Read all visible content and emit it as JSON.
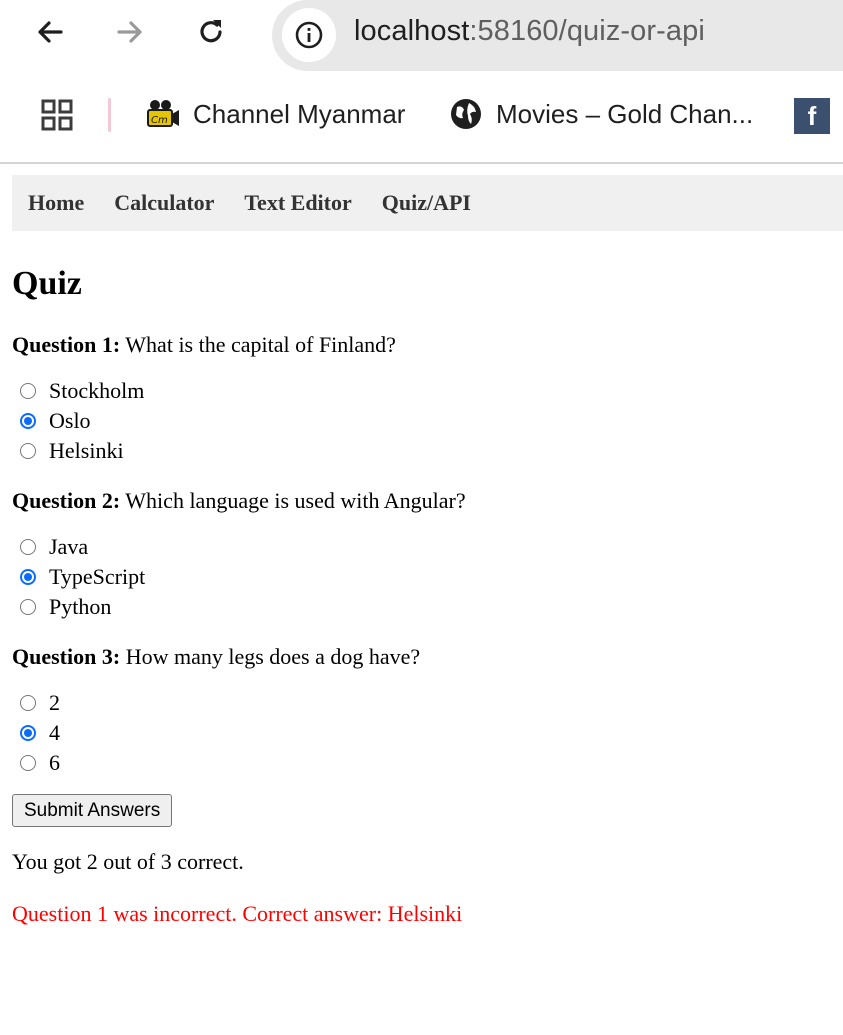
{
  "browser": {
    "url_host": "localhost",
    "url_rest": ":58160/quiz-or-api",
    "bookmarks": [
      {
        "label": "Channel Myanmar",
        "icon": "film-camera-icon"
      },
      {
        "label": "Movies – Gold Chan...",
        "icon": "globe-icon"
      }
    ],
    "facebook_icon_letter": "f"
  },
  "nav": {
    "home": "Home",
    "calculator": "Calculator",
    "text_editor": "Text Editor",
    "quiz_api": "Quiz/API"
  },
  "page": {
    "title": "Quiz",
    "questions": [
      {
        "label": "Question 1:",
        "text": "What is the capital of Finland?",
        "options": [
          "Stockholm",
          "Oslo",
          "Helsinki"
        ],
        "selected": "Oslo"
      },
      {
        "label": "Question 2:",
        "text": "Which language is used with Angular?",
        "options": [
          "Java",
          "TypeScript",
          "Python"
        ],
        "selected": "TypeScript"
      },
      {
        "label": "Question 3:",
        "text": "How many legs does a dog have?",
        "options": [
          "2",
          "4",
          "6"
        ],
        "selected": "4"
      }
    ],
    "submit_label": "Submit Answers",
    "result": "You got 2 out of 3 correct.",
    "error": "Question 1 was incorrect. Correct answer: Helsinki"
  },
  "colors": {
    "radio_checked": "#0b6bff",
    "error_text": "#ff0000",
    "nav_bg": "#f0f0f0"
  }
}
